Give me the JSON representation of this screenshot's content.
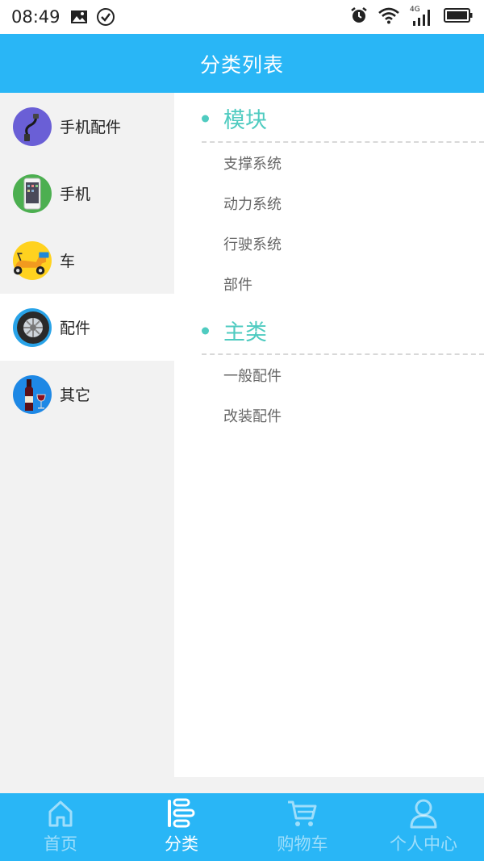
{
  "status_bar": {
    "time": "08:49",
    "network": "4G"
  },
  "header": {
    "title": "分类列表"
  },
  "sidebar": {
    "items": [
      {
        "label": "手机配件",
        "icon": "usb-cable-icon",
        "color": "#6a5fd6",
        "active": false
      },
      {
        "label": "手机",
        "icon": "smartphone-icon",
        "color": "#4caf50",
        "active": false
      },
      {
        "label": "车",
        "icon": "scooter-icon",
        "color": "#ffd21f",
        "active": false
      },
      {
        "label": "配件",
        "icon": "tire-icon",
        "color": "#29a3e8",
        "active": true
      },
      {
        "label": "其它",
        "icon": "wine-bottle-icon",
        "color": "#1e88e5",
        "active": false
      }
    ]
  },
  "content": {
    "sections": [
      {
        "title": "模块",
        "items": [
          "支撑系统",
          "动力系统",
          "行驶系统",
          "部件"
        ]
      },
      {
        "title": "主类",
        "items": [
          "一般配件",
          "改装配件"
        ]
      }
    ]
  },
  "bottom_nav": {
    "items": [
      {
        "label": "首页",
        "icon": "home-icon",
        "active": false
      },
      {
        "label": "分类",
        "icon": "category-icon",
        "active": true
      },
      {
        "label": "购物车",
        "icon": "cart-icon",
        "active": false
      },
      {
        "label": "个人中心",
        "icon": "user-icon",
        "active": false
      }
    ]
  },
  "colors": {
    "primary": "#29b6f6",
    "accent": "#4fcbc0",
    "sidebar_bg": "#f2f2f2"
  }
}
